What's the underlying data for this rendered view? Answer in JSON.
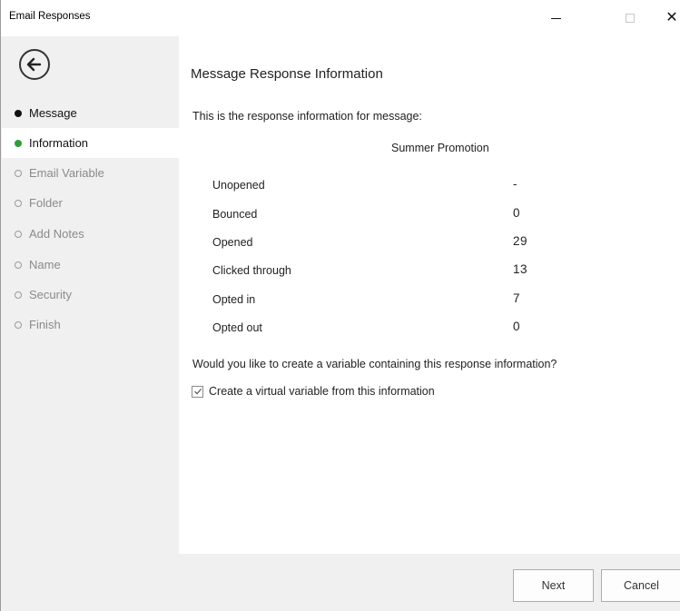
{
  "window": {
    "title": "Email Responses",
    "controls": {
      "minimize_icon": "minimize-icon",
      "maximize_icon": "maximize-icon",
      "close_label": "✕"
    }
  },
  "sidebar": {
    "back_icon": "back-arrow-icon",
    "items": [
      {
        "label": "Message",
        "state": "done"
      },
      {
        "label": "Information",
        "state": "current"
      },
      {
        "label": "Email Variable",
        "state": "pending"
      },
      {
        "label": "Folder",
        "state": "pending"
      },
      {
        "label": "Add Notes",
        "state": "pending"
      },
      {
        "label": "Name",
        "state": "pending"
      },
      {
        "label": "Security",
        "state": "pending"
      },
      {
        "label": "Finish",
        "state": "pending"
      }
    ]
  },
  "main": {
    "heading": "Message Response Information",
    "intro": "This is the response information for message:",
    "message_name": "Summer Promotion",
    "stats": [
      {
        "label": "Unopened",
        "value": "-"
      },
      {
        "label": "Bounced",
        "value": "0"
      },
      {
        "label": "Opened",
        "value": "29"
      },
      {
        "label": "Clicked through",
        "value": "13"
      },
      {
        "label": "Opted in",
        "value": "7"
      },
      {
        "label": "Opted out",
        "value": "0"
      }
    ],
    "question": "Would you like to create a variable containing this response information?",
    "checkbox": {
      "label": "Create a virtual variable from this information",
      "checked": true
    }
  },
  "footer": {
    "next_label": "Next",
    "cancel_label": "Cancel"
  },
  "colors": {
    "current_step": "#2e9e3a",
    "panel_bg": "#f0f0f0",
    "content_bg": "#ffffff"
  }
}
